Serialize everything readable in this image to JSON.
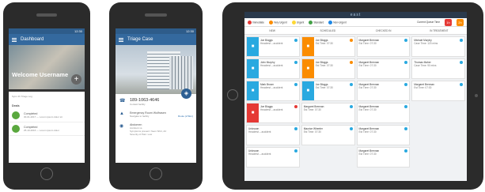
{
  "phone1": {
    "status_time": "12:30",
    "header_title": "Dashboard",
    "welcome": "Welcome Username",
    "subtitle": "Sync 2h Triage Log",
    "section": "Deals",
    "rows": [
      {
        "status": "Completed",
        "detail": "30-01-2017 — Lorem ipsum dolor sit"
      },
      {
        "status": "Completed",
        "detail": "25-10-2016 — Lorem ipsum dolor"
      }
    ]
  },
  "phone2": {
    "status_time": "12:30",
    "header_title": "Triage Case",
    "phone_number": "189-1063-4646",
    "phone_sub": "Contact facility",
    "facility": "Emergency Room Wolfrasen",
    "facility_sub": "Navigate to facility",
    "facility_link": "Route (2.5km)",
    "case_title": "Abdomen",
    "case_lines": [
      "Accident vs.",
      "Symptoms present: Neon Shirt, Art",
      "Severity of Pain: Low"
    ]
  },
  "tablet": {
    "brand": "east",
    "legend": [
      {
        "label": "Immediate",
        "color": "#e53935"
      },
      {
        "label": "Very Urgent",
        "color": "#fb8c00"
      },
      {
        "label": "Urgent",
        "color": "#fdd835"
      },
      {
        "label": "Standard",
        "color": "#43a047"
      },
      {
        "label": "Non-Urgent",
        "color": "#1e88e5"
      }
    ],
    "queue_label": "Current Queue Time",
    "queue_buttons": [
      {
        "label": "1h",
        "color": "#e53935"
      },
      {
        "label": "2h",
        "color": "#fb8c00"
      }
    ],
    "columns": [
      "NEW",
      "SCHEDULED",
      "CHECKED IN",
      "IN TREATMENT"
    ],
    "cards": [
      [
        {
          "name": "Joe Bloggs",
          "line": "Headrest – accident",
          "color": "#29a9e0"
        },
        {
          "name": "John Murphy",
          "line": "Headrest – accident",
          "color": "#29a9e0"
        },
        {
          "name": "Mark Brown",
          "line": "Headrest – accident",
          "color": "#29a9e0"
        },
        {
          "name": "Joe Bloggs",
          "line": "Headrest – accident",
          "color": "#e53935"
        },
        {
          "name": "Unknown",
          "line": "Headrest – accident",
          "color": ""
        },
        {
          "name": "Unknown",
          "line": "Headrest – accident",
          "color": ""
        }
      ],
      [
        {
          "name": "Joe Bloggs",
          "line": "Est Time: 07:30",
          "color": "#fb8c00"
        },
        {
          "name": "Joe Bloggs",
          "line": "Est Time: 07:30",
          "color": "#fb8c00"
        },
        {
          "name": "Joe Bloggs",
          "line": "Est Time: 07:30",
          "color": "#29a9e0"
        },
        {
          "name": "Margaret Brennan",
          "line": "Est Time: 07:30",
          "color": ""
        },
        {
          "name": "Maurice Wheeler",
          "line": "Est Time: 07:30",
          "color": ""
        }
      ],
      [
        {
          "name": "Margaret Brennan",
          "line": "Est Time: 07:30",
          "color": ""
        },
        {
          "name": "Margaret Brennan",
          "line": "Est Time: 07:30",
          "color": ""
        },
        {
          "name": "Margaret Brennan",
          "line": "Est Time: 07:30",
          "color": ""
        },
        {
          "name": "Margaret Brennan",
          "line": "Est Time: 07:30",
          "color": ""
        },
        {
          "name": "Margaret Brennan",
          "line": "Est Time: 07:30",
          "color": ""
        },
        {
          "name": "Margaret Brennan",
          "line": "Est Time: 07:30",
          "color": ""
        }
      ],
      [
        {
          "name": "Michael Murphy",
          "line": "Case Time: 120 mins",
          "color": ""
        },
        {
          "name": "Thomas Maher",
          "line": "Case Time: 90 mins",
          "color": ""
        },
        {
          "name": "Margaret Brennan",
          "line": "Est Time: 07:30",
          "color": ""
        }
      ]
    ]
  }
}
